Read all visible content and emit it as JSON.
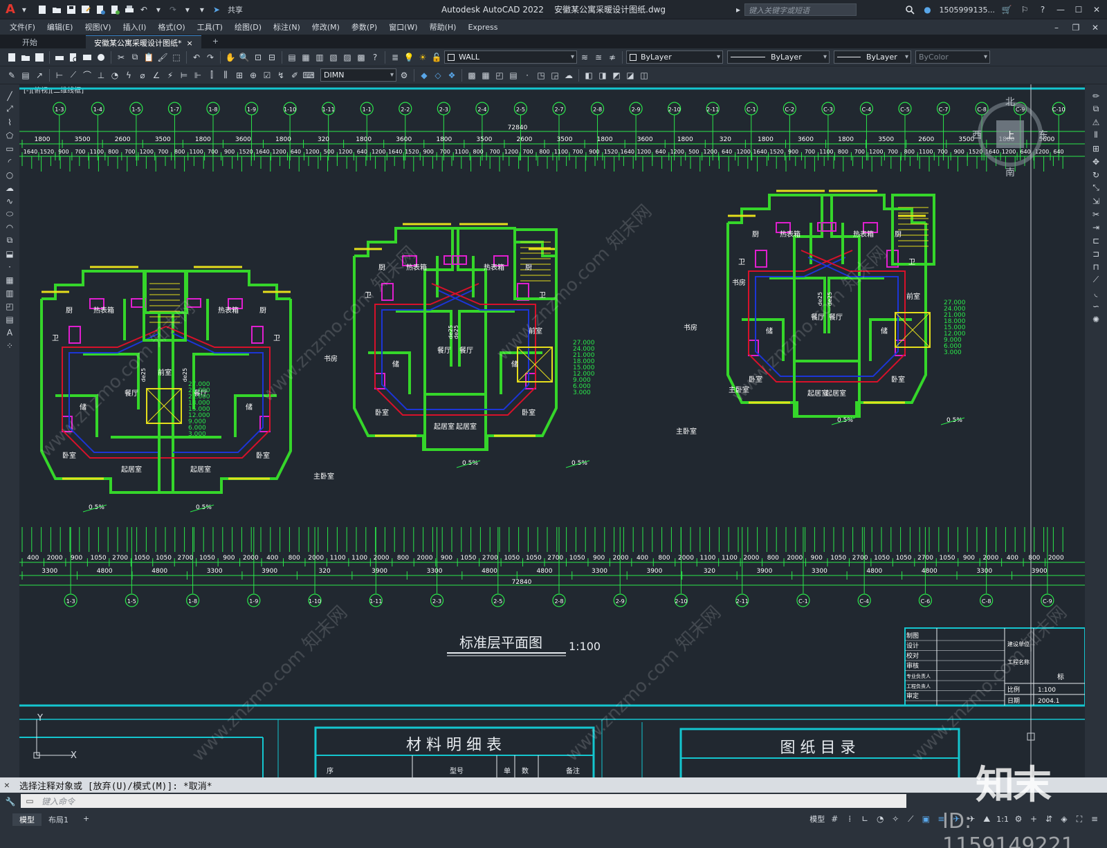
{
  "app": {
    "product": "Autodesk AutoCAD 2022",
    "file": "安徽某公寓采暖设计图纸.dwg",
    "share": "共享",
    "search_placeholder": "键入关键字或短语",
    "user": "1505999135..."
  },
  "menu": [
    "文件(F)",
    "编辑(E)",
    "视图(V)",
    "插入(I)",
    "格式(O)",
    "工具(T)",
    "绘图(D)",
    "标注(N)",
    "修改(M)",
    "参数(P)",
    "窗口(W)",
    "帮助(H)",
    "Express"
  ],
  "tabs": {
    "start": "开始",
    "active": "安徽某公寓采暖设计图纸*",
    "close": "×",
    "add": "+"
  },
  "properties": {
    "layer": "WALL",
    "color": "ByLayer",
    "linetype": "ByLayer",
    "lineweight": "ByLayer",
    "plotstyle": "ByColor",
    "dimstyle": "DIMN"
  },
  "drawing": {
    "view_label": "[-][俯视][二维线框]",
    "title": "标准层平面图",
    "scale": "1:100",
    "overall_dim": "72840",
    "top_axes": [
      "1-3",
      "1-4",
      "1-5",
      "1-7",
      "1-8",
      "1-9",
      "1-10",
      "1-11",
      "1-1",
      "2-2",
      "2-3",
      "2-4",
      "2-5",
      "2-7",
      "2-8",
      "2-9",
      "2-10",
      "2-11",
      "C-1",
      "C-2",
      "C-3",
      "C-4",
      "C-5",
      "C-7",
      "C-8",
      "C-9",
      "C-10"
    ],
    "top_dims_row1": [
      "1800",
      "3500",
      "2600",
      "3500",
      "1800",
      "3600",
      "1800",
      "320",
      "1800",
      "3600",
      "1800",
      "3500",
      "2600",
      "3500",
      "1800",
      "3600",
      "1800",
      "320",
      "1800",
      "3600",
      "1800",
      "3500",
      "2600",
      "3500",
      "1800",
      "3600"
    ],
    "top_dims_row2": [
      "1640",
      "1520",
      "900",
      "700",
      "1100",
      "800",
      "700",
      "1200",
      "700",
      "800",
      "1100",
      "700",
      "900",
      "1520",
      "1640",
      "1200",
      "640",
      "1200",
      "500",
      "1200",
      "640",
      "1200",
      "1640",
      "1520",
      "900",
      "700",
      "1100",
      "800",
      "700",
      "1200",
      "700",
      "800",
      "1100",
      "700",
      "900",
      "1520",
      "1640",
      "1200",
      "640",
      "1200",
      "500",
      "1200",
      "640",
      "1200",
      "1640",
      "1520",
      "900",
      "700",
      "1100",
      "800",
      "700",
      "1200",
      "700",
      "800",
      "1100",
      "700",
      "900",
      "1520",
      "1640",
      "1200",
      "640",
      "1200",
      "640"
    ],
    "bottom_axes": [
      "1-3",
      "1-5",
      "1-8",
      "1-9",
      "1-10",
      "1-11",
      "2-3",
      "2-5",
      "2-8",
      "2-9",
      "2-10",
      "2-11",
      "C-1",
      "C-4",
      "C-6",
      "C-8",
      "C-9"
    ],
    "bottom_dims_row1": [
      "400",
      "2000",
      "900",
      "1050",
      "2700",
      "1050",
      "1050",
      "2700",
      "1050",
      "900",
      "2000",
      "400",
      "800",
      "2000",
      "1100",
      "1100",
      "2000",
      "800",
      "2000",
      "900",
      "1050",
      "2700",
      "1050",
      "1050",
      "2700",
      "1050",
      "900",
      "2000",
      "400",
      "800",
      "2000",
      "1100",
      "1100",
      "2000",
      "800",
      "2000",
      "900",
      "1050",
      "2700",
      "1050",
      "1050",
      "2700",
      "1050",
      "900",
      "2000",
      "400",
      "800",
      "2000"
    ],
    "bottom_dims_row2": [
      "3300",
      "4800",
      "4800",
      "3300",
      "3900",
      "320",
      "3900",
      "3300",
      "4800",
      "4800",
      "3300",
      "3900",
      "320",
      "3900",
      "3300",
      "4800",
      "4800",
      "3300",
      "3900"
    ],
    "room_labels": {
      "kitchen": "厨",
      "dining": "餐厅",
      "living": "起居室",
      "bedroom": "卧室",
      "master": "主卧室",
      "study": "书房",
      "storage": "储",
      "bath": "卫",
      "stair": "前室",
      "heat": "热表箱"
    },
    "elevations": [
      "27.000",
      "24.000",
      "21.000",
      "18.000",
      "15.000",
      "12.000",
      "9.000",
      "6.000",
      "3.000"
    ],
    "pipe": "de25",
    "slope": "0.5%",
    "compass": {
      "n": "北",
      "s": "南",
      "e": "东",
      "w": "西",
      "center": "上"
    },
    "title_block": {
      "rows": [
        "制图",
        "设计",
        "校对",
        "审核",
        "专业负责人",
        "工程负责人",
        "审定"
      ],
      "cols": [
        "建设单位",
        "工程名称"
      ],
      "scale_label": "比例",
      "scale_value": "1:100",
      "date_label": "日期",
      "date_value": "2004.1",
      "sheet_label": "标"
    },
    "tables": {
      "material": "材 料 明 细 表",
      "drawing_list": "图 纸 目 录",
      "mat_cols": [
        "序",
        "型号",
        "单",
        "数",
        "备注"
      ]
    },
    "ucs": {
      "x": "X",
      "y": "Y"
    }
  },
  "command": {
    "history": "选择注释对象或 [放弃(U)/模式(M)]: *取消*",
    "placeholder": "键入命令"
  },
  "status": {
    "model_tab": "模型",
    "layout_tab": "布局1",
    "add": "+",
    "model_btn": "模型",
    "scale": "1:1"
  },
  "watermark": {
    "brand": "知末",
    "id": "ID: 1159149221",
    "site": "www.znzmo.com 知末网"
  },
  "colors": {
    "background": "#212830",
    "wall": "#35d62a",
    "hot_pipe": "#d8112a",
    "ret_pipe": "#1c35d6",
    "fixture": "#e01fcf",
    "window": "#e5de1c",
    "axis": "#2ae84a",
    "dim": "#ffffff",
    "frame": "#14c6cf"
  }
}
